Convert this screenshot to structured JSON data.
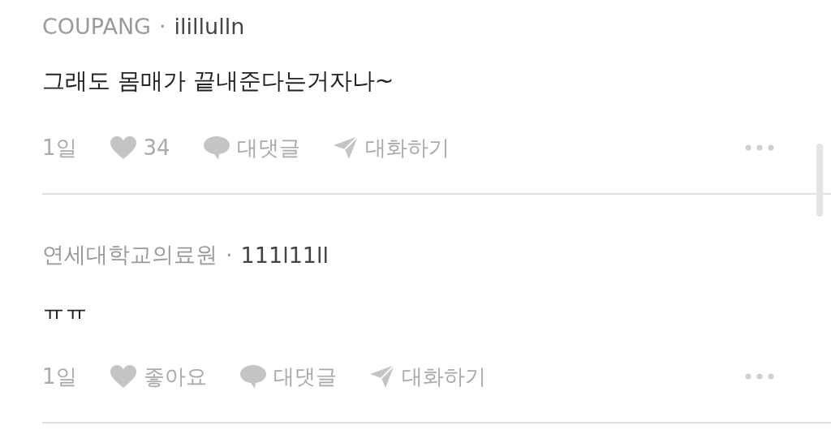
{
  "comments": [
    {
      "company": "COUPANG",
      "separator": "·",
      "handle": "ilillulln",
      "body": "그래도 몸매가 끝내준다는거자나~",
      "time": "1일",
      "like": "34",
      "reply": "대댓글",
      "chat": "대화하기"
    },
    {
      "company": "연세대학교의료원",
      "separator": "·",
      "handle": "111l11ll",
      "body": "ㅠㅠ",
      "time": "1일",
      "like": "좋아요",
      "reply": "대댓글",
      "chat": "대화하기"
    }
  ]
}
